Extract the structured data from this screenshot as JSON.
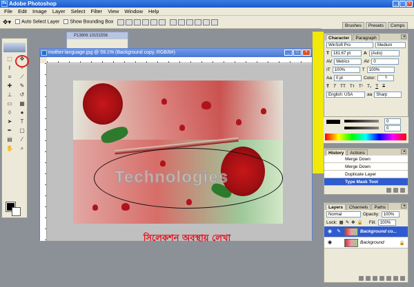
{
  "app": {
    "title": "Adobe Photoshop",
    "icon": "photoshop-app-icon"
  },
  "menu": [
    "File",
    "Edit",
    "Image",
    "Layer",
    "Select",
    "Filter",
    "View",
    "Window",
    "Help"
  ],
  "options": {
    "auto_select": "Auto Select Layer",
    "bounding_box": "Show Bounding Box"
  },
  "dock_tabs": [
    "Brushes",
    "Presets",
    "Comps"
  ],
  "bg_doc_title": "P13806 10151556",
  "document": {
    "title": "mother-language.jpg @ 59.1% (Background copy, RGB/8#)",
    "mask_text": "Technologies",
    "caption": "সিলেকশন অবস্থায় লেখা"
  },
  "character": {
    "tabs": [
      "Character",
      "Paragraph"
    ],
    "font_family": "WinSoft Pro",
    "font_style": "Medium",
    "size": "181.67 pt",
    "leading": "(Auto)",
    "kerning": "Metrics",
    "tracking": "0",
    "vscale": "100%",
    "hscale": "100%",
    "baseline": "0 pt",
    "color_label": "Color:",
    "color_value": "?",
    "language": "English: USA",
    "antialias": "Sharp",
    "aa_label": "aa",
    "grad_values": [
      "0",
      "0"
    ]
  },
  "history": {
    "tabs": [
      "History",
      "Actions"
    ],
    "items": [
      "Merge Down",
      "Merge Down",
      "Duplicate Layer",
      "Type Mask Tool"
    ]
  },
  "layers": {
    "tabs": [
      "Layers",
      "Channels",
      "Paths"
    ],
    "blend_mode": "Normal",
    "opacity_label": "Opacity:",
    "opacity": "100%",
    "lock_label": "Lock:",
    "fill_label": "Fill:",
    "fill": "100%",
    "items": [
      "Background co...",
      "Background"
    ]
  },
  "colors": {
    "accent": "#2f5bd0",
    "caption": "#e00e1a",
    "yellow": "#f2e90a"
  }
}
